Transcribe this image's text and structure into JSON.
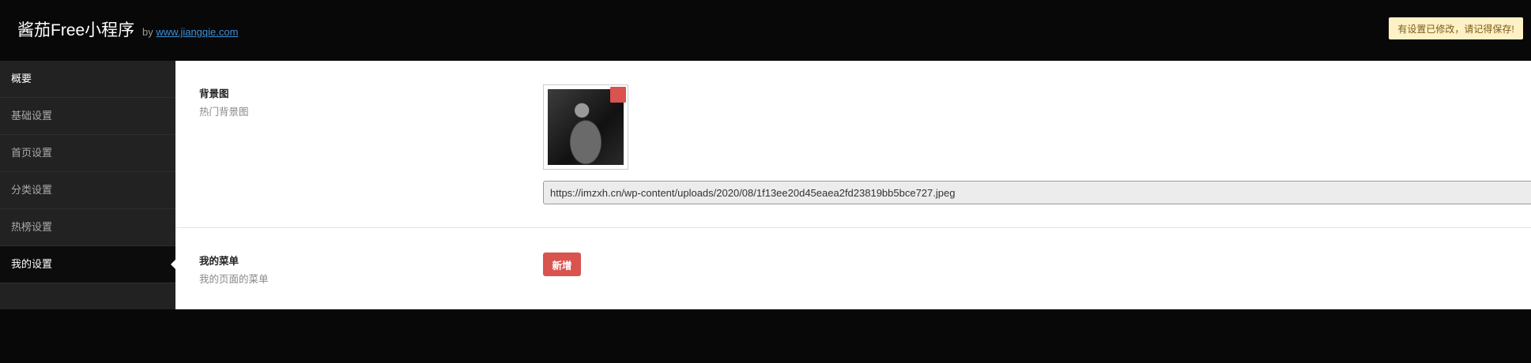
{
  "header": {
    "brand": "酱茄Free小程序",
    "by": "by",
    "site_link": "www.jiangqie.com",
    "notice": "有设置已修改，请记得保存!"
  },
  "sidebar": {
    "items": [
      {
        "label": "概要"
      },
      {
        "label": "基础设置"
      },
      {
        "label": "首页设置"
      },
      {
        "label": "分类设置"
      },
      {
        "label": "热榜设置"
      },
      {
        "label": "我的设置"
      }
    ],
    "active_index": 5
  },
  "settings": {
    "background": {
      "title": "背景图",
      "desc": "热门背景图",
      "url": "https://imzxh.cn/wp-content/uploads/2020/08/1f13ee20d45eaea2fd23819bb5bce727.jpeg"
    },
    "menu": {
      "title": "我的菜单",
      "desc": "我的页面的菜单",
      "add_label": "新增"
    }
  },
  "colors": {
    "accent_red": "#d9534f",
    "notice_bg": "#fdf1c5",
    "link": "#3f8fd6"
  }
}
